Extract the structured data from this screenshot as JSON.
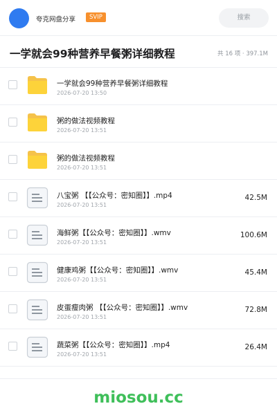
{
  "header": {
    "sharer_name": "夸克网盘分享",
    "badge": "SVIP",
    "search_label": "搜索",
    "colors": {
      "avatar": "#2f7bf0",
      "badge": "#f7902d"
    }
  },
  "title_row": {
    "title": "一学就会99种营养早餐粥详细教程",
    "summary": "共 16 项 · 397.1M"
  },
  "files": [
    {
      "type": "folder",
      "icon": "folder-icon",
      "name": "一学就会99种营养早餐粥详细教程",
      "date": "2026-07-20 13:50",
      "size": ""
    },
    {
      "type": "folder",
      "icon": "folder-icon",
      "name": "粥的做法视频教程",
      "date": "2026-07-20 13:51",
      "size": ""
    },
    {
      "type": "folder",
      "icon": "folder-icon",
      "name": "粥的做法视频教程",
      "date": "2026-07-20 13:51",
      "size": ""
    },
    {
      "type": "file",
      "icon": "file-icon",
      "name": "八宝粥 【【公众号：密知圈】】.mp4",
      "date": "2026-07-20 13:51",
      "size": "42.5M"
    },
    {
      "type": "file",
      "icon": "file-icon",
      "name": "海鲜粥【【公众号：密知圈】】.wmv",
      "date": "2026-07-20 13:51",
      "size": "100.6M"
    },
    {
      "type": "file",
      "icon": "file-icon",
      "name": "健康鸡粥【【公众号：密知圈】】.wmv",
      "date": "2026-07-20 13:51",
      "size": "45.4M"
    },
    {
      "type": "file",
      "icon": "file-icon",
      "name": "皮蛋瘦肉粥 【【公众号：密知圈】】.wmv",
      "date": "2026-07-20 13:51",
      "size": "72.8M"
    },
    {
      "type": "file",
      "icon": "file-icon",
      "name": "蔬菜粥【【公众号：密知圈】】.mp4",
      "date": "2026-07-20 13:51",
      "size": "26.4M"
    }
  ],
  "watermark": "miosou.cc"
}
